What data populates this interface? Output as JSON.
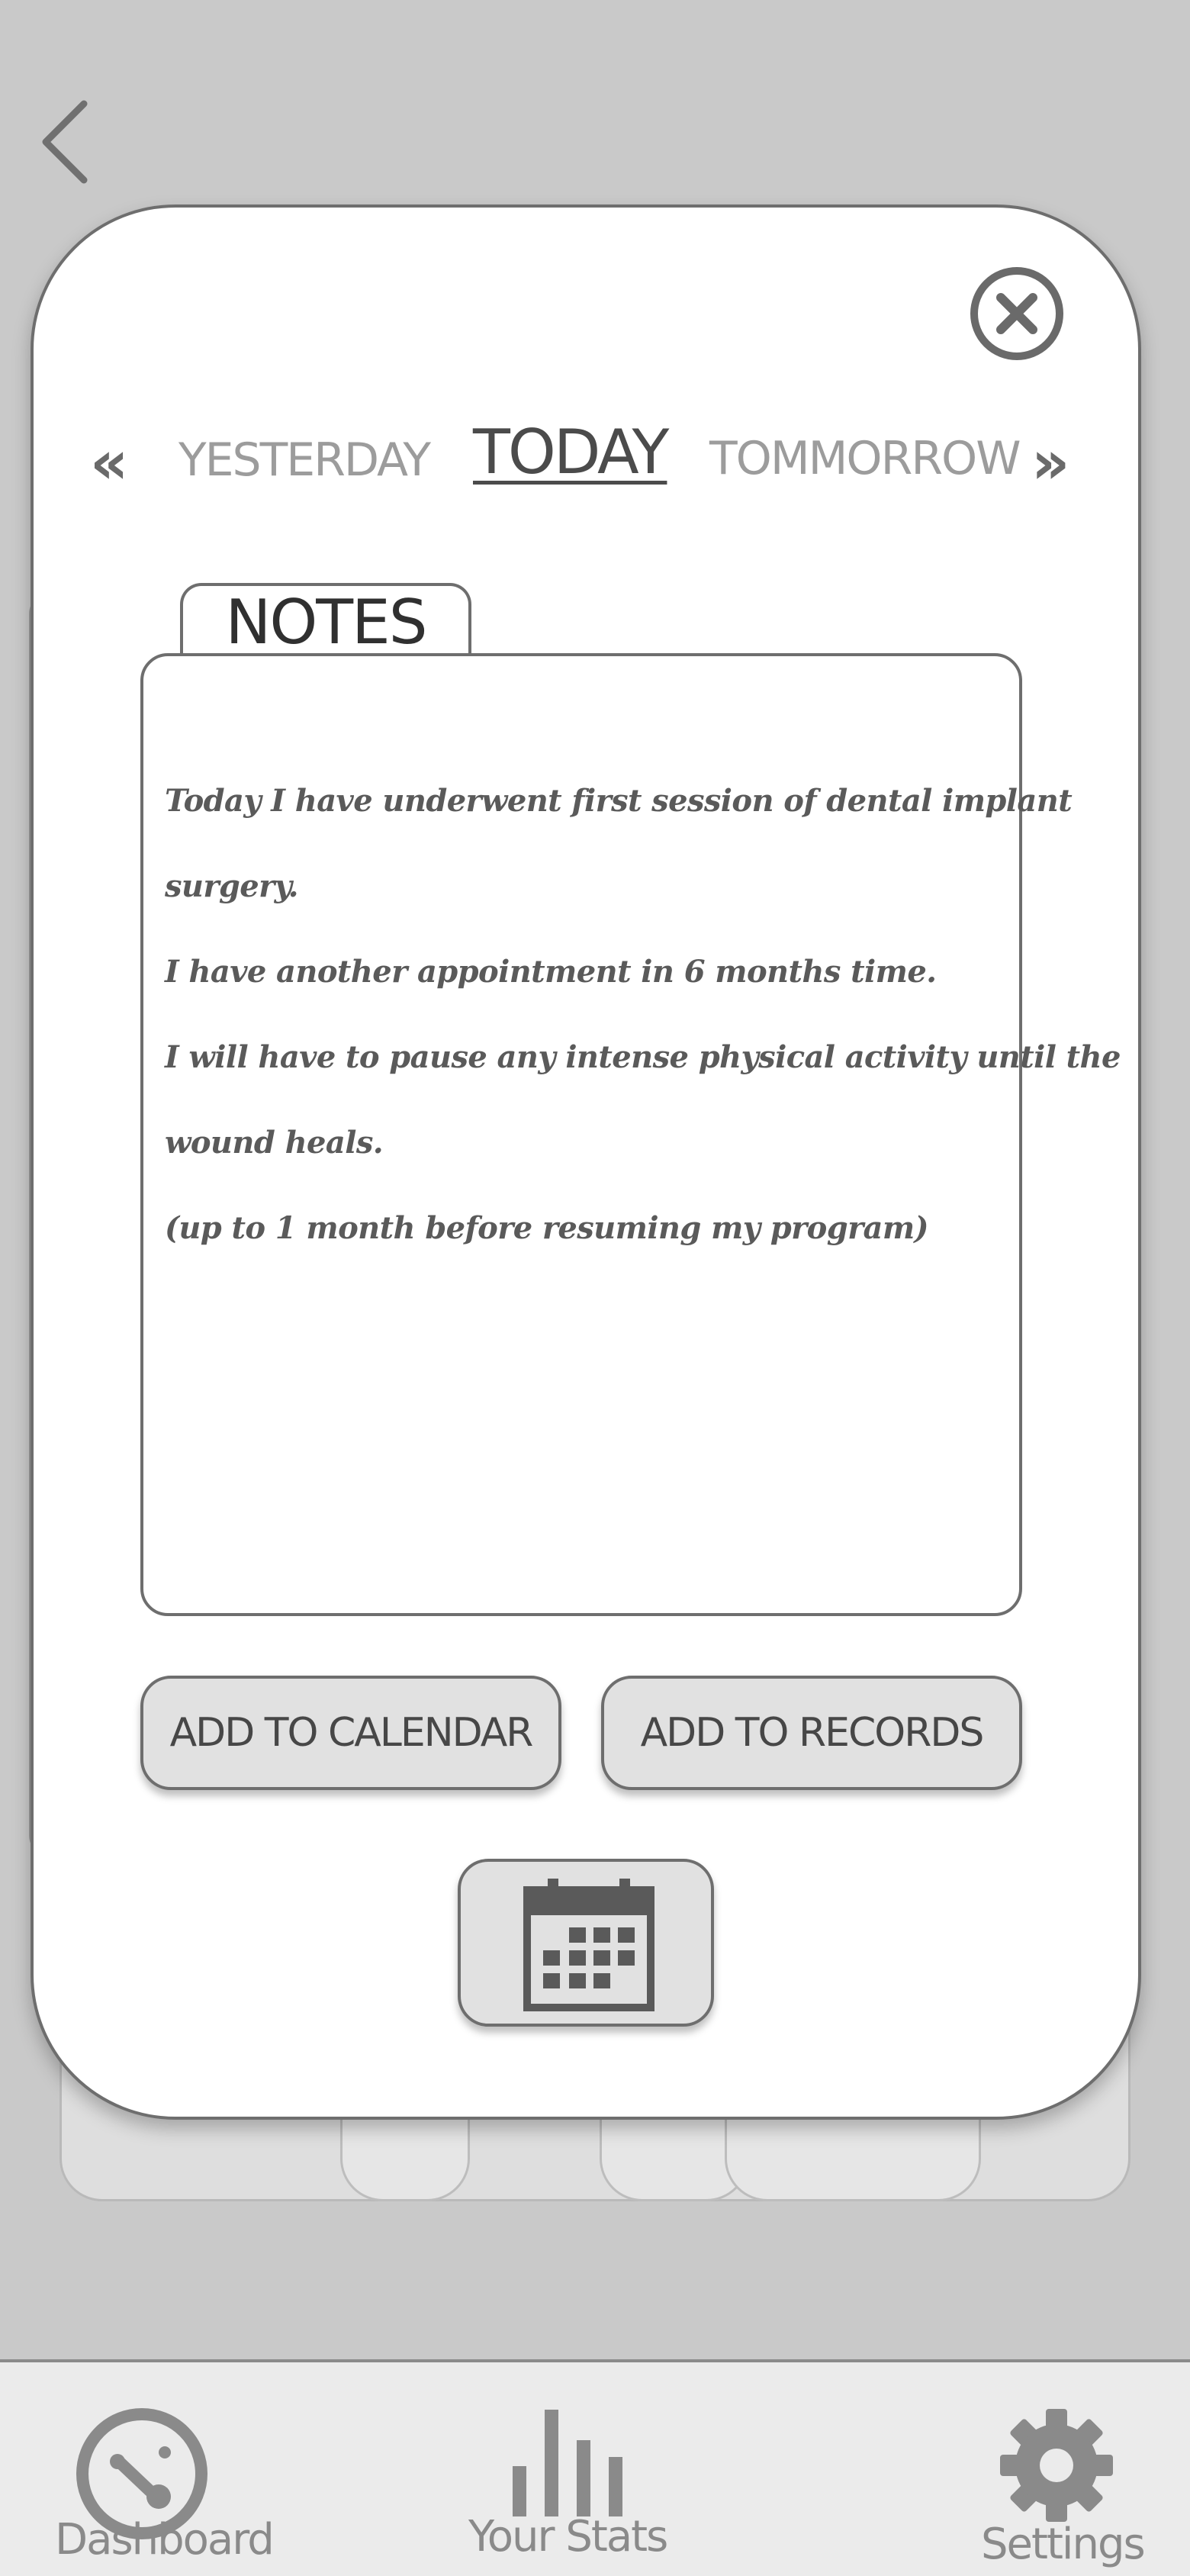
{
  "day_nav": {
    "prev_label": "«",
    "next_label": "»",
    "yesterday": "YESTERDAY",
    "today": "TODAY",
    "tomorrow": "TOMMORROW"
  },
  "notes": {
    "tab_label": "NOTES",
    "lines": [
      "Today I have underwent first session of dental implant",
      " surgery.",
      " I have another appointment in 6 months time.",
      "I will have to pause any intense physical activity until the",
      " wound heals.",
      "(up to 1 month before resuming my program)"
    ]
  },
  "actions": {
    "add_to_calendar": "ADD TO CALENDAR",
    "add_to_records": "ADD TO RECORDS"
  },
  "bottom_nav": {
    "dashboard": "Dashboard",
    "stats": "Your Stats",
    "settings": "Settings"
  },
  "icons": {
    "back": "chevron-left-icon",
    "close": "close-circle-icon",
    "calendar": "calendar-icon",
    "dashboard": "gauge-icon",
    "stats": "bar-chart-icon",
    "settings": "gear-icon"
  },
  "colors": {
    "background": "#c9c9c9",
    "modal": "#ffffff",
    "border": "#6e6e6e",
    "button": "#e1e1e1",
    "nav_bar": "#ebebeb"
  }
}
